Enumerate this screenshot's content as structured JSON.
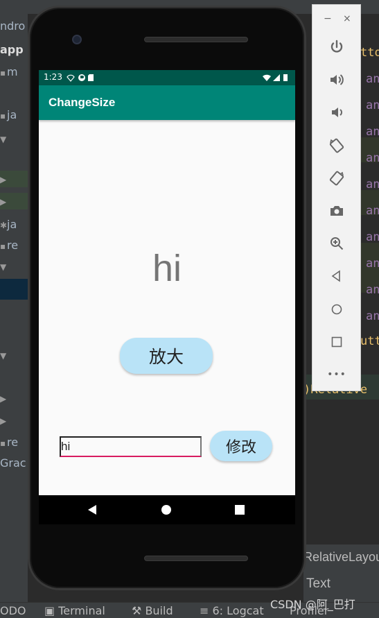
{
  "ide": {
    "tree_rows": [
      {
        "text": "ndro",
        "sel": false
      },
      {
        "text": "app",
        "sel": false
      },
      {
        "text": "m",
        "sel": false
      },
      {
        "text": "ja",
        "sel": false
      },
      {
        "text": "re",
        "sel": false
      },
      {
        "text": "ja",
        "sel": false
      },
      {
        "text": "re",
        "sel": false
      },
      {
        "text": "re",
        "sel": false
      },
      {
        "text": "Grac",
        "sel": false
      }
    ],
    "code_lines": [
      "tto",
      "an",
      "an",
      "an",
      "an",
      "an",
      "an",
      "an",
      "an",
      "an",
      "an",
      "utt",
      ")Relative"
    ],
    "design_tab": "RelativeLayou",
    "text_tab": "Text",
    "status_bar": {
      "todo": "ODO",
      "terminal": "Terminal",
      "build": "Build",
      "logcat": "6: Logcat",
      "profiler": "Profiler"
    },
    "watermark": "CSDN @阿_巴打"
  },
  "emulator_toolbar": {
    "minimize": "−",
    "close": "×",
    "buttons": [
      "power-icon",
      "volume-up-icon",
      "volume-down-icon",
      "rotate-left-icon",
      "rotate-right-icon",
      "camera-icon",
      "zoom-icon",
      "back-icon",
      "home-icon",
      "overview-icon",
      "more-icon"
    ],
    "more_label": "•••"
  },
  "phone": {
    "status_time": "1:23",
    "app_title": "ChangeSize",
    "display_text": "hi",
    "enlarge_button": "放大",
    "input_value": "hi",
    "modify_button": "修改",
    "colors": {
      "primary": "#008577",
      "primary_dark": "#00574b",
      "accent": "#d81b60",
      "button": "#b9e3f7"
    }
  }
}
